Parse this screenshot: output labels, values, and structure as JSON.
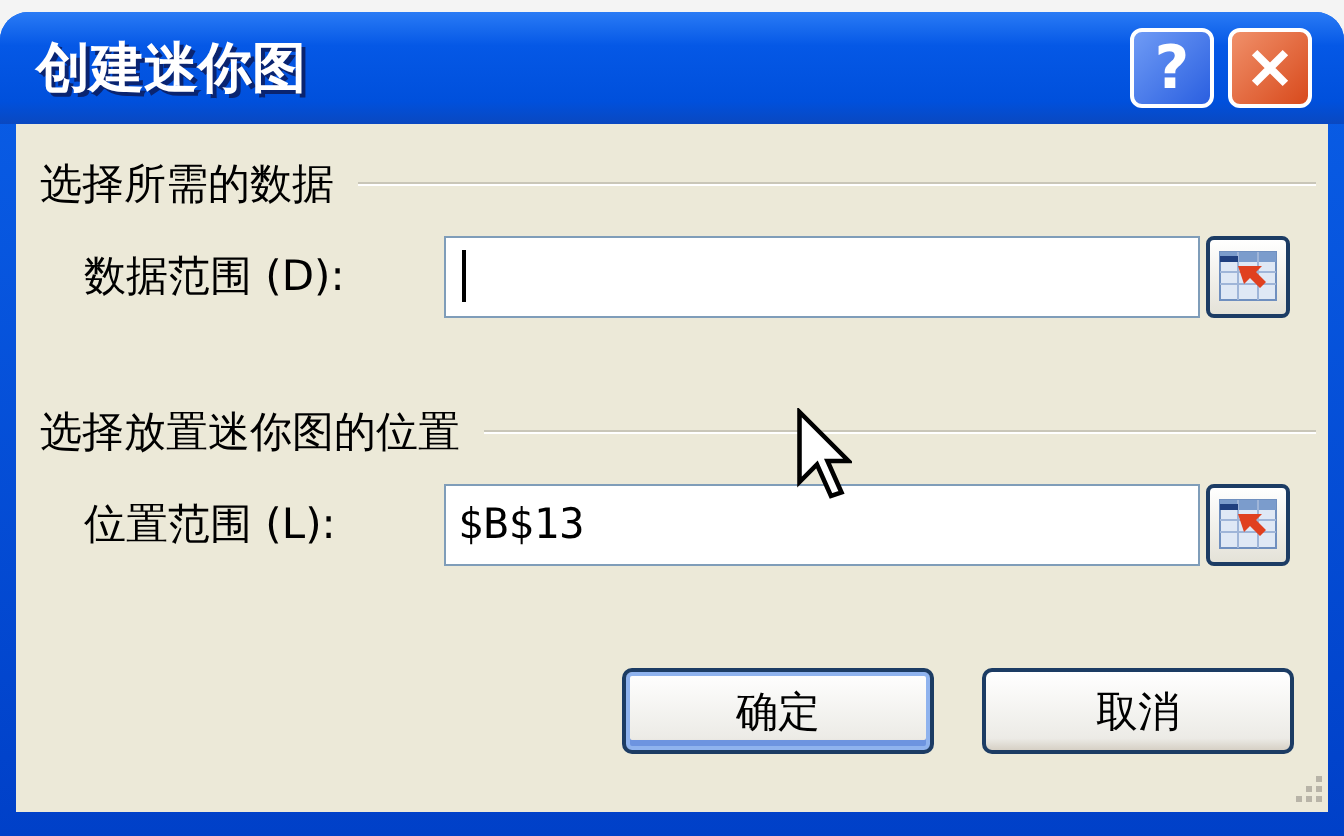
{
  "window": {
    "title": "创建迷你图",
    "help_button": "?"
  },
  "sections": [
    {
      "heading": "选择所需的数据",
      "field": {
        "label": "数据范围 (D):",
        "focused": true
      }
    },
    {
      "heading": "选择放置迷你图的位置",
      "field": {
        "label": "位置范围 (L):",
        "value": "$B$13",
        "focused": false
      }
    }
  ],
  "buttons": [
    {
      "label": "确定",
      "default": true
    },
    {
      "label": "取消",
      "default": false
    }
  ]
}
